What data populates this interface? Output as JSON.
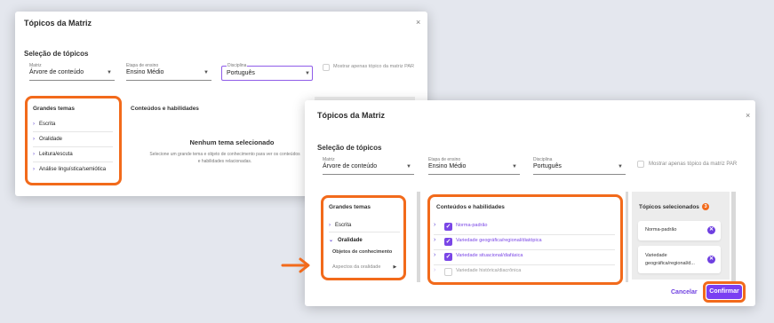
{
  "modal_back": {
    "title": "Tópicos da Matriz",
    "close": "×",
    "section_title": "Seleção de tópicos",
    "matriz": {
      "label": "Matriz",
      "value": "Árvore de conteúdo"
    },
    "etapa": {
      "label": "Etapa de ensino",
      "value": "Ensino Médio"
    },
    "disciplina": {
      "label": "Disciplina",
      "value": "Português"
    },
    "checkbox_label": "Mostrar apenas tópico da matriz PAR",
    "grandes_temas": {
      "header": "Grandes temas",
      "items": [
        "Escrita",
        "Oralidade",
        "Leitura/escuta",
        "Análise linguística/semiótica"
      ]
    },
    "conteudos_header": "Conteúdos e habilidades",
    "empty_title": "Nenhum tema selecionado",
    "empty_desc": "Selecione um grande tema e objeto de conhecimento para ver os conteúdos e habilidades relacionadas."
  },
  "modal_front": {
    "title": "Tópicos da Matriz",
    "close": "×",
    "section_title": "Seleção de tópicos",
    "matriz": {
      "label": "Matriz",
      "value": "Árvore de conteúdo"
    },
    "etapa": {
      "label": "Etapa de ensino",
      "value": "Ensino Médio"
    },
    "disciplina": {
      "label": "Disciplina",
      "value": "Português"
    },
    "checkbox_label": "Mostrar apenas tópico da matriz PAR",
    "grandes_temas": {
      "header": "Grandes temas",
      "items": [
        "Escrita",
        "Oralidade"
      ],
      "subitems": [
        "Objetos de conhecimento",
        "Aspectos da oralidade"
      ]
    },
    "conteudos": {
      "header": "Conteúdos e habilidades",
      "items": [
        {
          "label": "Norma-padrão",
          "checked": true
        },
        {
          "label": "Variedade geográfica/regional/diatópica",
          "checked": true
        },
        {
          "label": "Variedade situacional/diafásica",
          "checked": true
        },
        {
          "label": "Variedade histórica/diacrônica",
          "checked": false
        }
      ]
    },
    "selecionados": {
      "header": "Tópicos selecionados",
      "count": "3",
      "items": [
        "Norma-padrão",
        "Variedade geográfica/regional/d..."
      ]
    },
    "cancel_label": "Cancelar",
    "confirm_label": "Confirmar"
  },
  "colors": {
    "accent_purple": "#7a3ff2",
    "highlight_orange": "#f26a1b",
    "badge_orange": "#f26a1b"
  }
}
